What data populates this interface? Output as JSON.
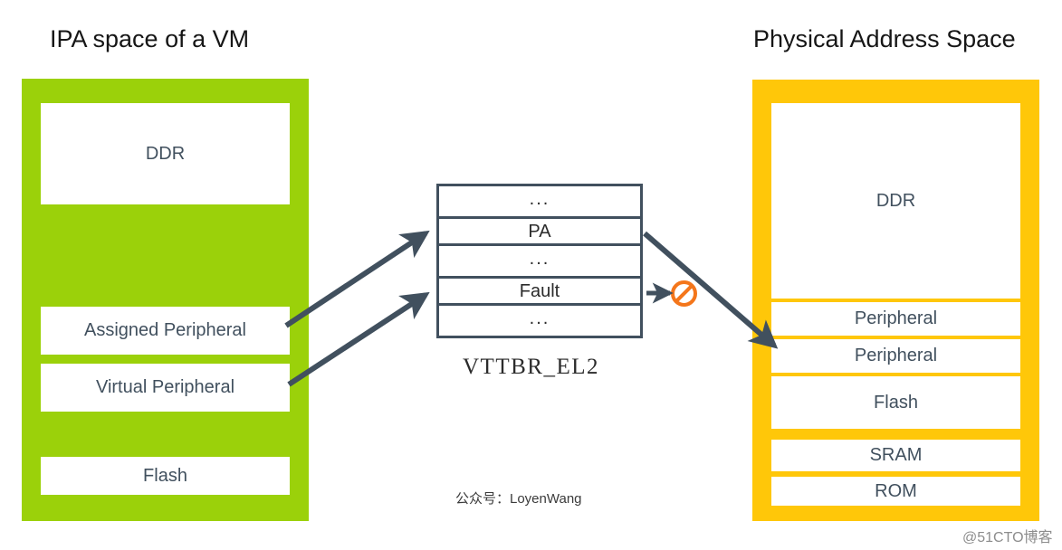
{
  "meta": {
    "top_cut_text": "",
    "colors": {
      "ipa_block": "#9BD10A",
      "pas_block": "#FFC709",
      "region_fill": "#FFFFFF",
      "region_text": "#41505E",
      "arrow": "#41505E",
      "table_border": "#41505E",
      "prohibited": "#F4761B"
    }
  },
  "left": {
    "title": "IPA space of a VM",
    "regions": [
      {
        "label": "DDR"
      },
      {
        "label": "Assigned Peripheral"
      },
      {
        "label": "Virtual Peripheral"
      },
      {
        "label": "Flash"
      }
    ]
  },
  "center": {
    "table_label": "VTTBR_EL2",
    "rows": [
      {
        "label": "..."
      },
      {
        "label": "PA"
      },
      {
        "label": "..."
      },
      {
        "label": "Fault"
      },
      {
        "label": "..."
      }
    ],
    "prohibited_icon": "no-entry-icon"
  },
  "right": {
    "title": "Physical Address Space",
    "regions": [
      {
        "label": "DDR"
      },
      {
        "label": "Peripheral"
      },
      {
        "label": "Peripheral"
      },
      {
        "label": "Flash"
      },
      {
        "label": "SRAM"
      },
      {
        "label": "ROM"
      }
    ]
  },
  "watermarks": {
    "center": "公众号：LoyenWang",
    "corner": "@51CTO博客"
  }
}
